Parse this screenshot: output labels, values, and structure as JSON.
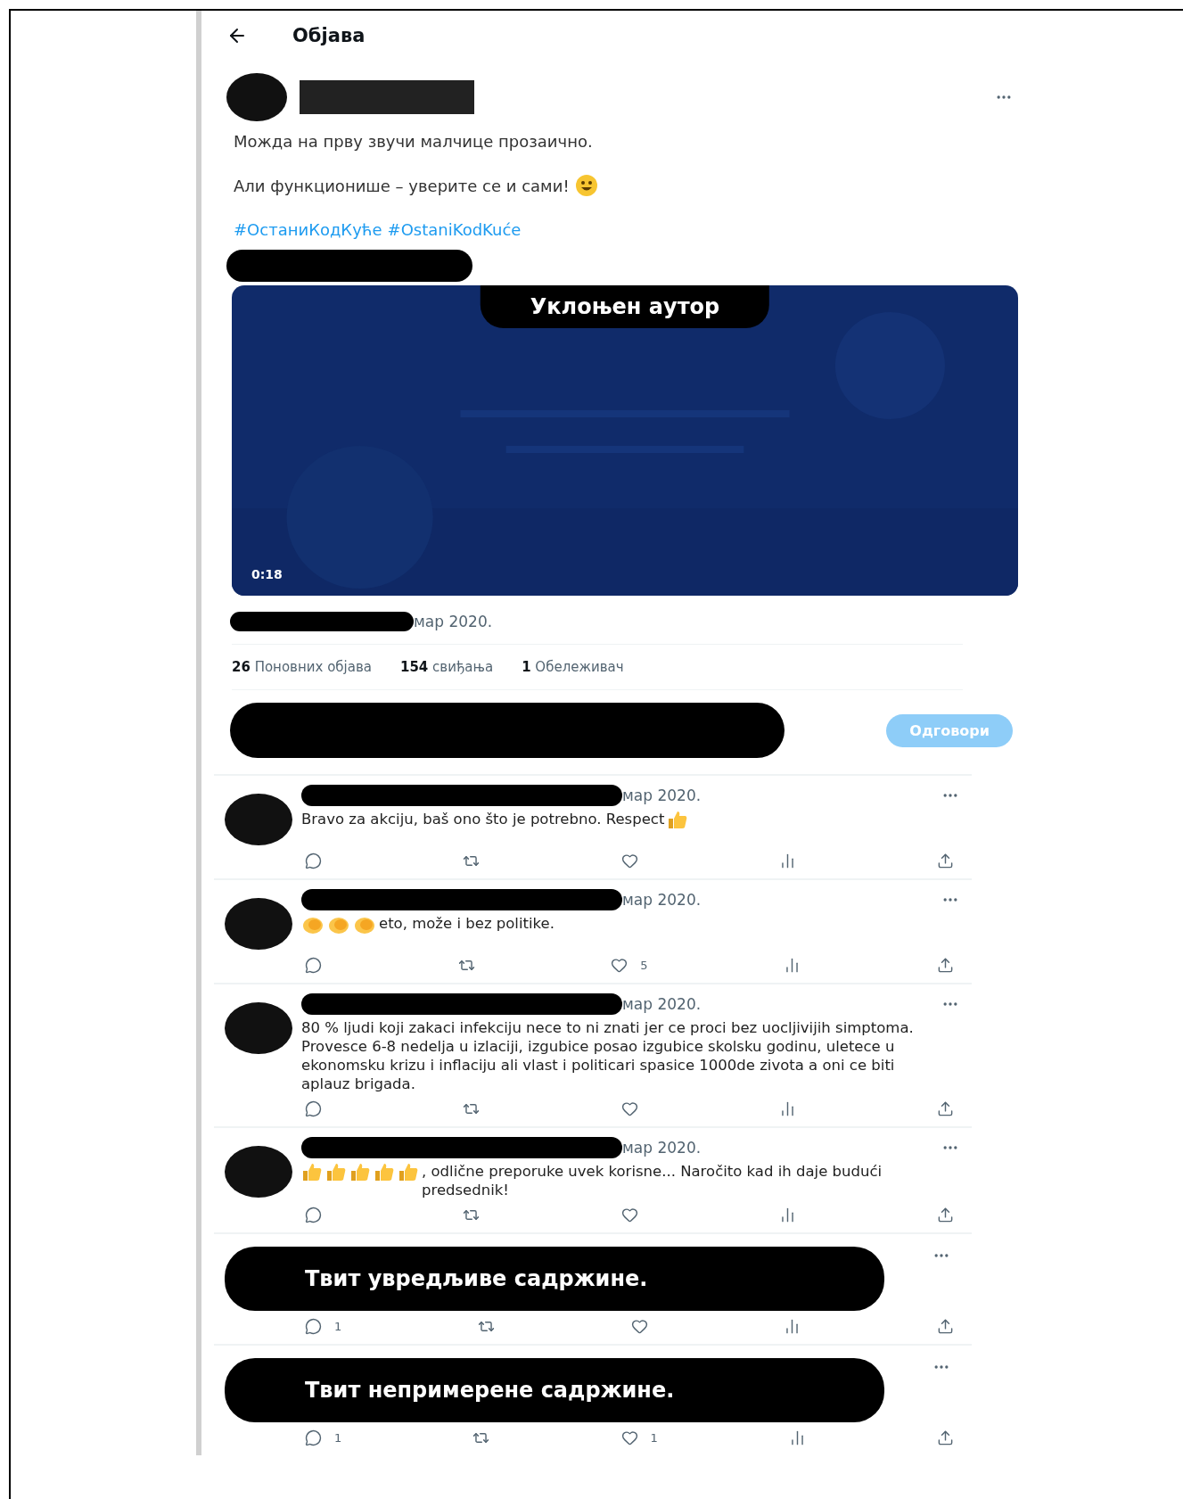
{
  "header": {
    "title": "Објава"
  },
  "post": {
    "paragraphs": [
      {
        "text": "Можда на прву звучи малчице прозаично."
      },
      {
        "text": "Али функционише – уверите се и сами!",
        "emoji": [
          {
            "kind": "smile"
          }
        ]
      }
    ],
    "hashtags": [
      "#ОстаниКодКуће",
      "#OstaniKodKuće"
    ],
    "video": {
      "kind": "picture",
      "label": "Уклоњен аутор",
      "duration": "0:18"
    },
    "date": "мар 2020.",
    "stats": [
      {
        "count": "26",
        "label": "Поновних објава"
      },
      {
        "count": "154",
        "label": "свиђања"
      },
      {
        "count": "1",
        "label": "Обележивач"
      }
    ]
  },
  "reply_box": {
    "button": "Одговори",
    "disabled": true
  },
  "comments": [
    {
      "kind": "text",
      "date": "мар 2020.",
      "text": "Bravo za akciju, baš ono što je potrebno. Respect",
      "emoji_after": [
        {
          "kind": "thumbs_up"
        }
      ],
      "actions": [
        {
          "kind": "reply"
        },
        {
          "kind": "repost"
        },
        {
          "kind": "like"
        },
        {
          "kind": "views"
        },
        {
          "kind": "share"
        }
      ]
    },
    {
      "kind": "text",
      "date": "мар 2020.",
      "text": "eto, može i bez politike.",
      "emoji_before": [
        {
          "kind": "clap"
        },
        {
          "kind": "clap"
        },
        {
          "kind": "clap"
        }
      ],
      "actions": [
        {
          "kind": "reply"
        },
        {
          "kind": "repost"
        },
        {
          "kind": "like",
          "count": "5"
        },
        {
          "kind": "views"
        },
        {
          "kind": "share"
        }
      ]
    },
    {
      "kind": "text",
      "date": "мар 2020.",
      "text": "80 % ljudi koji zakaci infekciju nece to ni znati jer ce proci bez uocljivijih simptoma. Provesce 6-8 nedelja u izlaciji, izgubice posao izgubice skolsku godinu, uletece u ekonomsku krizu i inflaciju  ali vlast i politicari spasice 1000de zivota a oni ce biti aplauz brigada.",
      "actions": [
        {
          "kind": "reply"
        },
        {
          "kind": "repost"
        },
        {
          "kind": "like"
        },
        {
          "kind": "views"
        },
        {
          "kind": "share"
        }
      ]
    },
    {
      "kind": "text",
      "date": "мар 2020.",
      "text": ", odlične preporuke uvek korisne... Naročito kad ih daje budući predsednik!",
      "emoji_before": [
        {
          "kind": "thumbs_up"
        },
        {
          "kind": "thumbs_up"
        },
        {
          "kind": "thumbs_up"
        },
        {
          "kind": "thumbs_up"
        },
        {
          "kind": "thumbs_up"
        }
      ],
      "actions": [
        {
          "kind": "reply"
        },
        {
          "kind": "repost"
        },
        {
          "kind": "like"
        },
        {
          "kind": "views"
        },
        {
          "kind": "share"
        }
      ]
    },
    {
      "kind": "redacted",
      "label": "Твит увредљиве садржине.",
      "actions": [
        {
          "kind": "reply",
          "count": "1"
        },
        {
          "kind": "repost"
        },
        {
          "kind": "like"
        },
        {
          "kind": "views"
        },
        {
          "kind": "share"
        }
      ]
    },
    {
      "kind": "redacted",
      "label": "Твит непримерене садржине.",
      "actions": [
        {
          "kind": "reply",
          "count": "1"
        },
        {
          "kind": "repost"
        },
        {
          "kind": "like",
          "count": "1"
        },
        {
          "kind": "views"
        },
        {
          "kind": "share"
        }
      ]
    }
  ]
}
